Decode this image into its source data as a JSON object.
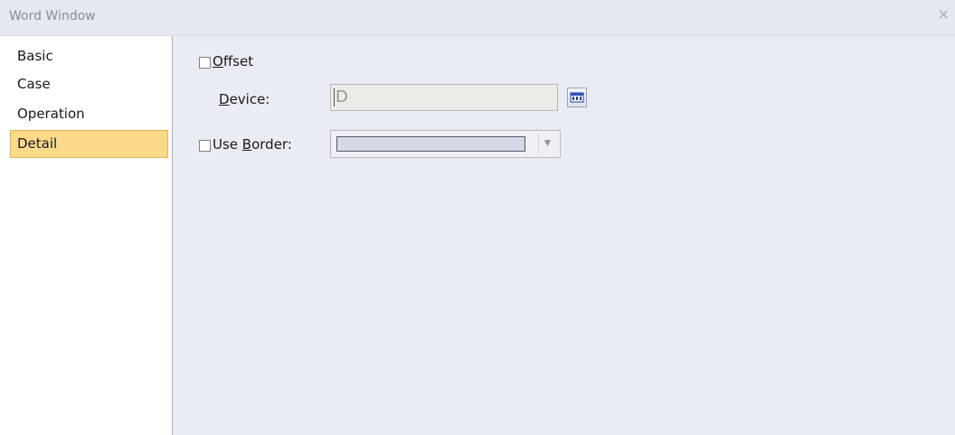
{
  "window": {
    "title": "Word Window",
    "close_glyph": "×"
  },
  "sidebar": {
    "items": [
      {
        "label": "Basic",
        "selected": false
      },
      {
        "label": "Case",
        "selected": false
      },
      {
        "label": "Operation",
        "selected": false
      },
      {
        "label": "Detail",
        "selected": true
      }
    ]
  },
  "detail": {
    "offset": {
      "label_mnemonic": "O",
      "label_rest": "ffset",
      "checked": false
    },
    "device": {
      "label_mnemonic": "D",
      "label_rest": "evice:",
      "value": "D",
      "browse_icon": "device-browse-icon"
    },
    "use_border": {
      "label_prefix": "Use ",
      "label_mnemonic": "B",
      "label_rest": "order:",
      "checked": false,
      "color": "#d5d8e6"
    }
  },
  "colors": {
    "selection_bg": "#fbd98b",
    "panel_bg": "#e9ecf4",
    "sidebar_bg": "#ffffff"
  }
}
